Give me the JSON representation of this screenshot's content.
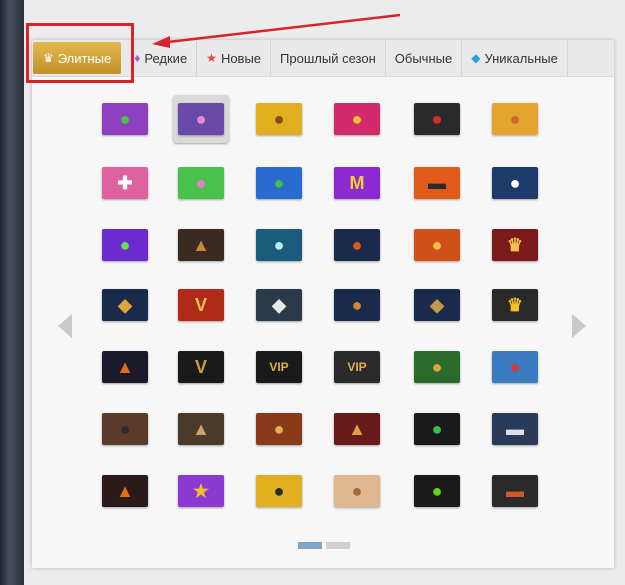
{
  "tabs": [
    {
      "label": "Элитные",
      "icon": "crown-icon",
      "glyph": "♛",
      "color": "#ffffff",
      "active": true
    },
    {
      "label": "Редкие",
      "icon": "diamond-icon",
      "glyph": "♦",
      "color": "#b54fd6",
      "active": false
    },
    {
      "label": "Новые",
      "icon": "star-icon",
      "glyph": "★",
      "color": "#e24a3b",
      "active": false
    },
    {
      "label": "Прошлый сезон",
      "icon": "",
      "glyph": "",
      "color": "",
      "active": false
    },
    {
      "label": "Обычные",
      "icon": "",
      "glyph": "",
      "color": "",
      "active": false
    },
    {
      "label": "Уникальные",
      "icon": "blue-diamond-icon",
      "glyph": "◆",
      "color": "#2a9fe0",
      "active": false
    }
  ],
  "accent": "#d8232a",
  "avatars": [
    [
      {
        "name": "green-monster-avatar",
        "bg": "#8e3fbf",
        "glyph": "●",
        "color": "#4fc24a"
      },
      {
        "name": "pink-boar-avatar",
        "bg": "#6a4aa8",
        "glyph": "●",
        "color": "#e58ccf",
        "selected": true
      },
      {
        "name": "lion-avatar",
        "bg": "#e0b020",
        "glyph": "●",
        "color": "#8a4a1a"
      },
      {
        "name": "punk-hedgehog-avatar",
        "bg": "#d12a6a",
        "glyph": "●",
        "color": "#f3c02a"
      },
      {
        "name": "mario-avatar",
        "bg": "#2a2a2a",
        "glyph": "●",
        "color": "#e02a2a"
      },
      {
        "name": "hamster-avatar",
        "bg": "#e3a530",
        "glyph": "●",
        "color": "#c86a2a"
      }
    ],
    [
      {
        "name": "skull-mask-avatar",
        "bg": "#e061a0",
        "glyph": "✚",
        "color": "#ffffff"
      },
      {
        "name": "tiger-mask-avatar",
        "bg": "#48c24a",
        "glyph": "●",
        "color": "#f07ad0"
      },
      {
        "name": "cartoon-brawler-avatar",
        "bg": "#2a6bd0",
        "glyph": "●",
        "color": "#3ec24a"
      },
      {
        "name": "max-badge-avatar",
        "bg": "#8a2ad0",
        "glyph": "M",
        "color": "#f3d02a"
      },
      {
        "name": "monster-truck-avatar",
        "bg": "#e05a1a",
        "glyph": "▬",
        "color": "#2a2a2a"
      },
      {
        "name": "dark-hero-avatar",
        "bg": "#1e3a6a",
        "glyph": "●",
        "color": "#ffffff"
      }
    ],
    [
      {
        "name": "purple-creature-avatar",
        "bg": "#6a2ad0",
        "glyph": "●",
        "color": "#6adf4a"
      },
      {
        "name": "bronze-dragon-avatar",
        "bg": "#3a2a20",
        "glyph": "▲",
        "color": "#c08a3a"
      },
      {
        "name": "ice-dragon-avatar",
        "bg": "#1a5a7a",
        "glyph": "●",
        "color": "#bfe8f5"
      },
      {
        "name": "phoenix-emblem-avatar",
        "bg": "#1a2a4a",
        "glyph": "●",
        "color": "#e05a1a"
      },
      {
        "name": "flaming-skull-avatar",
        "bg": "#d0501a",
        "glyph": "●",
        "color": "#f5c04a"
      },
      {
        "name": "red-crown-avatar",
        "bg": "#7a1a1a",
        "glyph": "♛",
        "color": "#f3c04a"
      }
    ],
    [
      {
        "name": "gold-crest-avatar",
        "bg": "#1a2a4a",
        "glyph": "◆",
        "color": "#e0a53a"
      },
      {
        "name": "vip-shield-red-avatar",
        "bg": "#b02a1a",
        "glyph": "V",
        "color": "#f3c04a"
      },
      {
        "name": "silver-emblem-avatar",
        "bg": "#2a3a4a",
        "glyph": "◆",
        "color": "#e8e8e8"
      },
      {
        "name": "lion-shield-avatar",
        "bg": "#1a2a4a",
        "glyph": "●",
        "color": "#d08a2a"
      },
      {
        "name": "winged-crest-avatar",
        "bg": "#1a2a4a",
        "glyph": "◆",
        "color": "#c09a4a"
      },
      {
        "name": "gold-crown-avatar",
        "bg": "#2a2a2a",
        "glyph": "♛",
        "color": "#f3c02a"
      }
    ],
    [
      {
        "name": "flame-blade-avatar",
        "bg": "#1a1a2a",
        "glyph": "▲",
        "color": "#e0701a"
      },
      {
        "name": "gold-v-avatar",
        "bg": "#1a1a1a",
        "glyph": "V",
        "color": "#d0a040"
      },
      {
        "name": "vip-gold-avatar",
        "bg": "#1a1a1a",
        "glyph": "VIP",
        "color": "#e0b04a"
      },
      {
        "name": "vip-dark-avatar",
        "bg": "#2a2a2a",
        "glyph": "VIP",
        "color": "#e0b04a"
      },
      {
        "name": "turtle-warrior-avatar",
        "bg": "#2a6a2a",
        "glyph": "●",
        "color": "#e0a03a"
      },
      {
        "name": "winter-dragon-avatar",
        "bg": "#3a7ac0",
        "glyph": "●",
        "color": "#d83a3a"
      }
    ],
    [
      {
        "name": "bear-avatar",
        "bg": "#5a3a2a",
        "glyph": "●",
        "color": "#2a2a2a"
      },
      {
        "name": "eye-pyramid-avatar",
        "bg": "#4a3a2a",
        "glyph": "▲",
        "color": "#d0a06a"
      },
      {
        "name": "monkey-king-avatar",
        "bg": "#8a3a1a",
        "glyph": "●",
        "color": "#e0b04a"
      },
      {
        "name": "horned-helmet-avatar",
        "bg": "#6a1a1a",
        "glyph": "▲",
        "color": "#e0a04a"
      },
      {
        "name": "green-dragon-avatar",
        "bg": "#1a1a1a",
        "glyph": "●",
        "color": "#3ac04a"
      },
      {
        "name": "silver-car-avatar",
        "bg": "#2a3a5a",
        "glyph": "▬",
        "color": "#e0e0e0"
      }
    ],
    [
      {
        "name": "fire-pyramid-avatar",
        "bg": "#2a1a1a",
        "glyph": "▲",
        "color": "#e0701a"
      },
      {
        "name": "gold-star-avatar",
        "bg": "#8a3ad0",
        "glyph": "★",
        "color": "#f3c02a"
      },
      {
        "name": "totoro-avatar",
        "bg": "#e0b020",
        "glyph": "●",
        "color": "#2a2a2a"
      },
      {
        "name": "teddy-bear-avatar",
        "bg": "#e0b890",
        "glyph": "●",
        "color": "#a06a3a"
      },
      {
        "name": "green-shadow-avatar",
        "bg": "#1a1a1a",
        "glyph": "●",
        "color": "#6ad020"
      },
      {
        "name": "sports-car-avatar",
        "bg": "#2a2a2a",
        "glyph": "▬",
        "color": "#d05a2a"
      }
    ]
  ],
  "pager": {
    "pages": 2,
    "current": 1
  }
}
